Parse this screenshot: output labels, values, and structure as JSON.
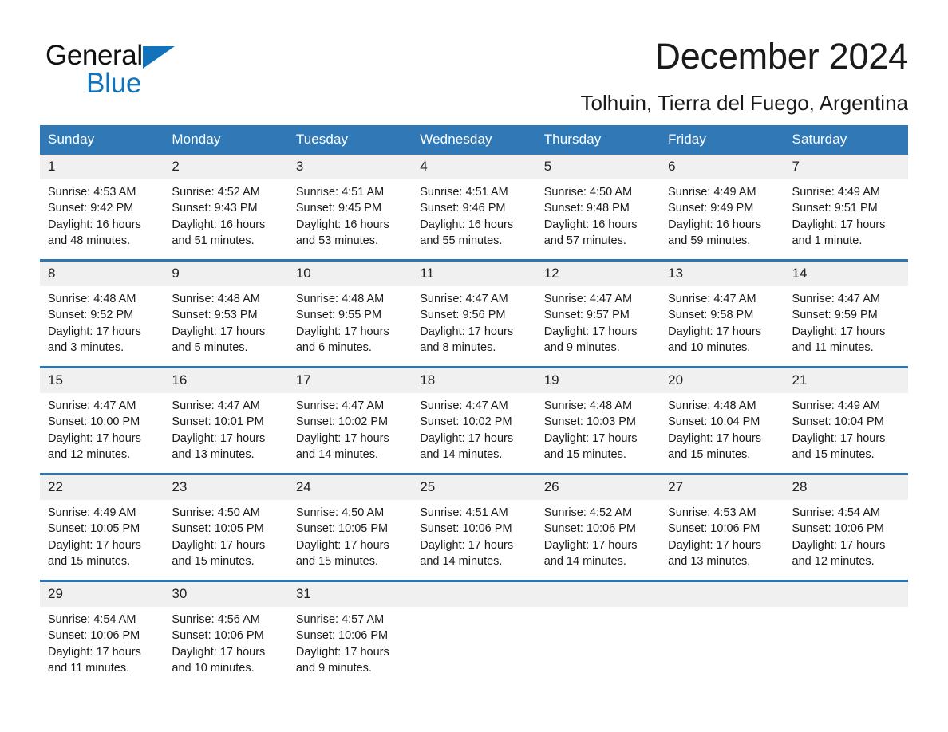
{
  "brand": {
    "name_part1": "General",
    "name_part2": "Blue",
    "triangle_color": "#1273ba"
  },
  "header": {
    "title": "December 2024",
    "subtitle": "Tolhuin, Tierra del Fuego, Argentina"
  },
  "colors": {
    "header_blue": "#3079b6",
    "row_rule_blue": "#2e74b0",
    "daynum_band": "#f0f0f0",
    "brand_blue": "#1273ba"
  },
  "weekday_headers": [
    "Sunday",
    "Monday",
    "Tuesday",
    "Wednesday",
    "Thursday",
    "Friday",
    "Saturday"
  ],
  "weeks": [
    [
      {
        "day": "1",
        "sunrise": "Sunrise: 4:53 AM",
        "sunset": "Sunset: 9:42 PM",
        "daylight": "Daylight: 16 hours and 48 minutes."
      },
      {
        "day": "2",
        "sunrise": "Sunrise: 4:52 AM",
        "sunset": "Sunset: 9:43 PM",
        "daylight": "Daylight: 16 hours and 51 minutes."
      },
      {
        "day": "3",
        "sunrise": "Sunrise: 4:51 AM",
        "sunset": "Sunset: 9:45 PM",
        "daylight": "Daylight: 16 hours and 53 minutes."
      },
      {
        "day": "4",
        "sunrise": "Sunrise: 4:51 AM",
        "sunset": "Sunset: 9:46 PM",
        "daylight": "Daylight: 16 hours and 55 minutes."
      },
      {
        "day": "5",
        "sunrise": "Sunrise: 4:50 AM",
        "sunset": "Sunset: 9:48 PM",
        "daylight": "Daylight: 16 hours and 57 minutes."
      },
      {
        "day": "6",
        "sunrise": "Sunrise: 4:49 AM",
        "sunset": "Sunset: 9:49 PM",
        "daylight": "Daylight: 16 hours and 59 minutes."
      },
      {
        "day": "7",
        "sunrise": "Sunrise: 4:49 AM",
        "sunset": "Sunset: 9:51 PM",
        "daylight": "Daylight: 17 hours and 1 minute."
      }
    ],
    [
      {
        "day": "8",
        "sunrise": "Sunrise: 4:48 AM",
        "sunset": "Sunset: 9:52 PM",
        "daylight": "Daylight: 17 hours and 3 minutes."
      },
      {
        "day": "9",
        "sunrise": "Sunrise: 4:48 AM",
        "sunset": "Sunset: 9:53 PM",
        "daylight": "Daylight: 17 hours and 5 minutes."
      },
      {
        "day": "10",
        "sunrise": "Sunrise: 4:48 AM",
        "sunset": "Sunset: 9:55 PM",
        "daylight": "Daylight: 17 hours and 6 minutes."
      },
      {
        "day": "11",
        "sunrise": "Sunrise: 4:47 AM",
        "sunset": "Sunset: 9:56 PM",
        "daylight": "Daylight: 17 hours and 8 minutes."
      },
      {
        "day": "12",
        "sunrise": "Sunrise: 4:47 AM",
        "sunset": "Sunset: 9:57 PM",
        "daylight": "Daylight: 17 hours and 9 minutes."
      },
      {
        "day": "13",
        "sunrise": "Sunrise: 4:47 AM",
        "sunset": "Sunset: 9:58 PM",
        "daylight": "Daylight: 17 hours and 10 minutes."
      },
      {
        "day": "14",
        "sunrise": "Sunrise: 4:47 AM",
        "sunset": "Sunset: 9:59 PM",
        "daylight": "Daylight: 17 hours and 11 minutes."
      }
    ],
    [
      {
        "day": "15",
        "sunrise": "Sunrise: 4:47 AM",
        "sunset": "Sunset: 10:00 PM",
        "daylight": "Daylight: 17 hours and 12 minutes."
      },
      {
        "day": "16",
        "sunrise": "Sunrise: 4:47 AM",
        "sunset": "Sunset: 10:01 PM",
        "daylight": "Daylight: 17 hours and 13 minutes."
      },
      {
        "day": "17",
        "sunrise": "Sunrise: 4:47 AM",
        "sunset": "Sunset: 10:02 PM",
        "daylight": "Daylight: 17 hours and 14 minutes."
      },
      {
        "day": "18",
        "sunrise": "Sunrise: 4:47 AM",
        "sunset": "Sunset: 10:02 PM",
        "daylight": "Daylight: 17 hours and 14 minutes."
      },
      {
        "day": "19",
        "sunrise": "Sunrise: 4:48 AM",
        "sunset": "Sunset: 10:03 PM",
        "daylight": "Daylight: 17 hours and 15 minutes."
      },
      {
        "day": "20",
        "sunrise": "Sunrise: 4:48 AM",
        "sunset": "Sunset: 10:04 PM",
        "daylight": "Daylight: 17 hours and 15 minutes."
      },
      {
        "day": "21",
        "sunrise": "Sunrise: 4:49 AM",
        "sunset": "Sunset: 10:04 PM",
        "daylight": "Daylight: 17 hours and 15 minutes."
      }
    ],
    [
      {
        "day": "22",
        "sunrise": "Sunrise: 4:49 AM",
        "sunset": "Sunset: 10:05 PM",
        "daylight": "Daylight: 17 hours and 15 minutes."
      },
      {
        "day": "23",
        "sunrise": "Sunrise: 4:50 AM",
        "sunset": "Sunset: 10:05 PM",
        "daylight": "Daylight: 17 hours and 15 minutes."
      },
      {
        "day": "24",
        "sunrise": "Sunrise: 4:50 AM",
        "sunset": "Sunset: 10:05 PM",
        "daylight": "Daylight: 17 hours and 15 minutes."
      },
      {
        "day": "25",
        "sunrise": "Sunrise: 4:51 AM",
        "sunset": "Sunset: 10:06 PM",
        "daylight": "Daylight: 17 hours and 14 minutes."
      },
      {
        "day": "26",
        "sunrise": "Sunrise: 4:52 AM",
        "sunset": "Sunset: 10:06 PM",
        "daylight": "Daylight: 17 hours and 14 minutes."
      },
      {
        "day": "27",
        "sunrise": "Sunrise: 4:53 AM",
        "sunset": "Sunset: 10:06 PM",
        "daylight": "Daylight: 17 hours and 13 minutes."
      },
      {
        "day": "28",
        "sunrise": "Sunrise: 4:54 AM",
        "sunset": "Sunset: 10:06 PM",
        "daylight": "Daylight: 17 hours and 12 minutes."
      }
    ],
    [
      {
        "day": "29",
        "sunrise": "Sunrise: 4:54 AM",
        "sunset": "Sunset: 10:06 PM",
        "daylight": "Daylight: 17 hours and 11 minutes."
      },
      {
        "day": "30",
        "sunrise": "Sunrise: 4:56 AM",
        "sunset": "Sunset: 10:06 PM",
        "daylight": "Daylight: 17 hours and 10 minutes."
      },
      {
        "day": "31",
        "sunrise": "Sunrise: 4:57 AM",
        "sunset": "Sunset: 10:06 PM",
        "daylight": "Daylight: 17 hours and 9 minutes."
      },
      {
        "day": "",
        "sunrise": "",
        "sunset": "",
        "daylight": ""
      },
      {
        "day": "",
        "sunrise": "",
        "sunset": "",
        "daylight": ""
      },
      {
        "day": "",
        "sunrise": "",
        "sunset": "",
        "daylight": ""
      },
      {
        "day": "",
        "sunrise": "",
        "sunset": "",
        "daylight": ""
      }
    ]
  ]
}
